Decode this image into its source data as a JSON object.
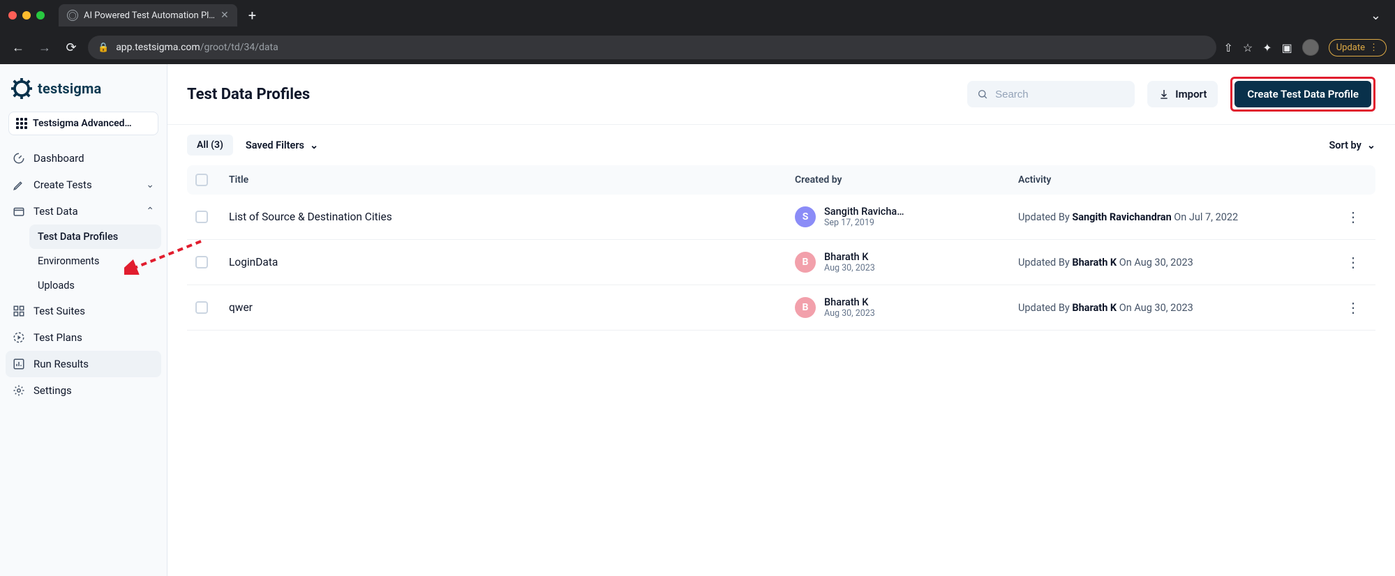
{
  "browser": {
    "tab_title": "AI Powered Test Automation Pl…",
    "url_host": "app.testsigma.com",
    "url_path": "/groot/td/34/data",
    "update_label": "Update"
  },
  "sidebar": {
    "product_name": "testsigma",
    "project_name": "Testsigma Advanced…",
    "items": {
      "dashboard": "Dashboard",
      "create_tests": "Create Tests",
      "test_data": "Test Data",
      "test_suites": "Test Suites",
      "test_plans": "Test Plans",
      "run_results": "Run Results",
      "settings": "Settings"
    },
    "test_data_children": {
      "profiles": "Test Data Profiles",
      "environments": "Environments",
      "uploads": "Uploads"
    }
  },
  "header": {
    "title": "Test Data Profiles",
    "search_placeholder": "Search",
    "import_label": "Import",
    "create_label": "Create Test Data Profile"
  },
  "filters": {
    "all_chip": "All (3)",
    "saved_filters": "Saved Filters",
    "sort_by": "Sort by"
  },
  "table": {
    "columns": {
      "title": "Title",
      "created_by": "Created by",
      "activity": "Activity"
    },
    "rows": [
      {
        "title": "List of Source & Destination Cities",
        "avatar_letter": "S",
        "avatar_color": "purple",
        "creator_name": "Sangith Ravicha…",
        "created_date": "Sep 17, 2019",
        "activity_prefix": "Updated By ",
        "activity_user": "Sangith Ravichandran",
        "activity_suffix": " On Jul 7, 2022"
      },
      {
        "title": "LoginData",
        "avatar_letter": "B",
        "avatar_color": "pink",
        "creator_name": "Bharath K",
        "created_date": "Aug 30, 2023",
        "activity_prefix": "Updated By ",
        "activity_user": "Bharath K",
        "activity_suffix": " On Aug 30, 2023"
      },
      {
        "title": "qwer",
        "avatar_letter": "B",
        "avatar_color": "pink",
        "creator_name": "Bharath K",
        "created_date": "Aug 30, 2023",
        "activity_prefix": "Updated By ",
        "activity_user": "Bharath K",
        "activity_suffix": " On Aug 30, 2023"
      }
    ]
  }
}
